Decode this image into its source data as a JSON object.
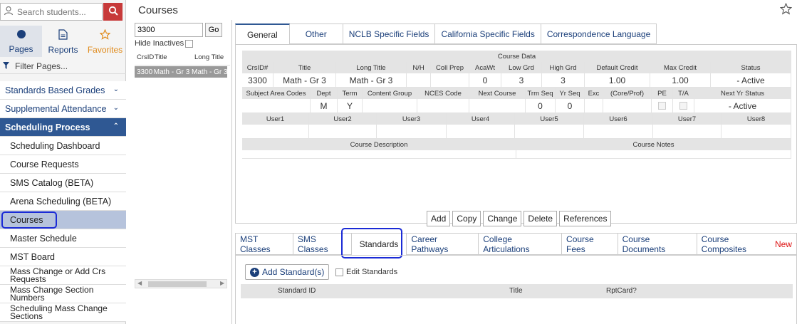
{
  "sidebar": {
    "search_placeholder": "Search students...",
    "nav": {
      "pages": "Pages",
      "reports": "Reports",
      "favorites": "Favorites"
    },
    "filter_label": "Filter Pages...",
    "groups": [
      {
        "label": "Standards Based Grades"
      },
      {
        "label": "Supplemental Attendance"
      },
      {
        "label": "Scheduling Process"
      }
    ],
    "items": [
      {
        "label": "Scheduling Dashboard"
      },
      {
        "label": "Course Requests"
      },
      {
        "label": "SMS Catalog (BETA)"
      },
      {
        "label": "Arena Scheduling (BETA)"
      },
      {
        "label": "Courses"
      },
      {
        "label": "Master Schedule"
      },
      {
        "label": "MST Board"
      },
      {
        "label": "Mass Change or Add Crs Requests"
      },
      {
        "label": "Mass Change Section Numbers"
      },
      {
        "label": "Scheduling Mass Change Sections"
      }
    ]
  },
  "header": {
    "title": "Courses"
  },
  "list": {
    "search_value": "3300",
    "go_label": "Go",
    "hide_inactives_label": "Hide Inactives",
    "columns": [
      "CrsID",
      "Title",
      "Long Title"
    ],
    "row": [
      "3300",
      "Math - Gr 3",
      "Math - Gr 3"
    ]
  },
  "tabs": [
    "General",
    "Other",
    "NCLB Specific Fields",
    "California Specific Fields",
    "Correspondence Language"
  ],
  "course": {
    "section_title": "Course Data",
    "r1_headers": [
      "CrsID#",
      "Title",
      "Long Title",
      "N/H",
      "Coll Prep",
      "AcaWt",
      "Low Grd",
      "High Grd",
      "Default Credit",
      "Max Credit",
      "Status"
    ],
    "r1_values": [
      "3300",
      "Math - Gr 3",
      "Math - Gr 3",
      "",
      "",
      "0",
      "3",
      "3",
      "1.00",
      "1.00",
      "- Active"
    ],
    "r2_headers": [
      "Subject Area Codes",
      "Dept",
      "Term",
      "Content Group",
      "NCES Code",
      "Next Course",
      "Trm Seq",
      "Yr Seq",
      "Exc",
      "(Core/Prof)",
      "PE",
      "T/A",
      "Next Yr Status"
    ],
    "r2_values": [
      "",
      "M",
      "Y",
      "",
      "",
      "",
      "0",
      "0",
      "",
      "",
      "",
      "",
      "- Active"
    ],
    "r3_headers": [
      "User1",
      "User2",
      "User3",
      "User4",
      "User5",
      "User6",
      "User7",
      "User8"
    ],
    "r4_headers": [
      "Course Description",
      "Course Notes"
    ]
  },
  "actions": [
    "Add",
    "Copy",
    "Change",
    "Delete",
    "References"
  ],
  "bottom_tabs": [
    "MST Classes",
    "SMS Classes",
    "Standards",
    "Career Pathways",
    "College Articulations",
    "Course Fees",
    "Course Documents",
    "Course Composites"
  ],
  "new_badge": "New",
  "standards": {
    "add_label": "Add Standard(s)",
    "edit_label": "Edit Standards",
    "columns": [
      "Standard ID",
      "Title",
      "RptCard?"
    ]
  },
  "colors": {
    "accent": "#2f5893",
    "search_button": "#c73a3a",
    "favorites": "#e08a1a",
    "highlight": "#1b2bd6"
  }
}
